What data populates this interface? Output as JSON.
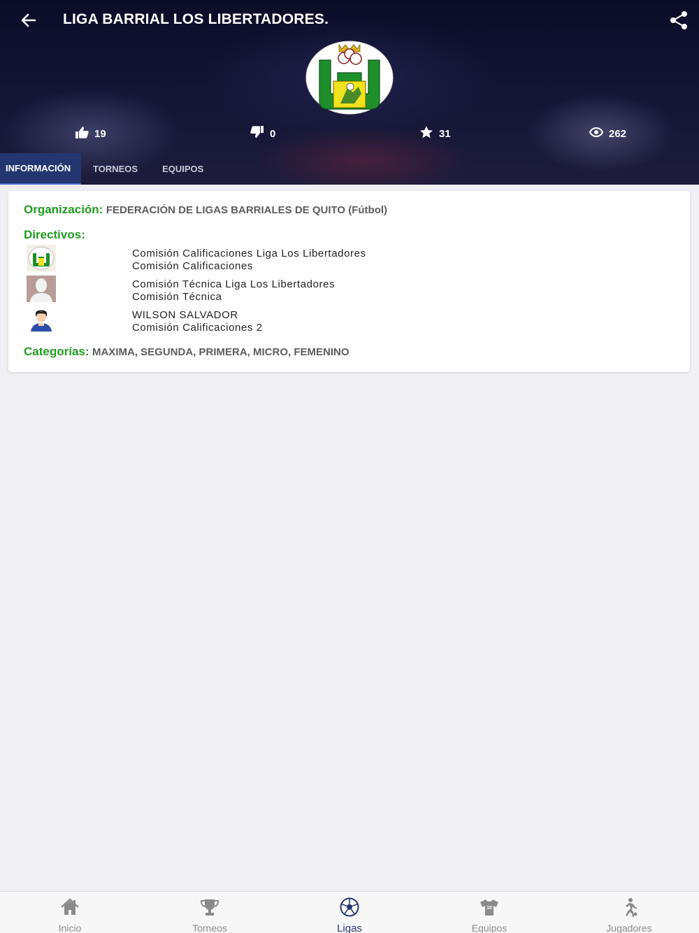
{
  "header": {
    "title": "LIGA BARRIAL LOS LIBERTADORES.",
    "back_icon": "arrow-left-icon",
    "share_icon": "share-icon"
  },
  "stats": [
    {
      "icon": "thumbs-up-icon",
      "value": "19"
    },
    {
      "icon": "thumbs-down-icon",
      "value": "0"
    },
    {
      "icon": "star-icon",
      "value": "31"
    },
    {
      "icon": "eye-icon",
      "value": "262"
    }
  ],
  "tabs": [
    {
      "label": "INFORMACIÓN",
      "active": true
    },
    {
      "label": "TORNEOS",
      "active": false
    },
    {
      "label": "EQUIPOS",
      "active": false
    }
  ],
  "info": {
    "organization_label": "Organización:",
    "organization_value": "FEDERACIÓN DE LIGAS BARRIALES DE QUITO (Fútbol)",
    "directivos_label": "Directivos:",
    "directivos": [
      {
        "name": "Comisión Calificaciones Liga Los Libertadores",
        "role": "Comisión Calificaciones"
      },
      {
        "name": "Comisión Técnica Liga Los Libertadores",
        "role": "Comisión Técnica"
      },
      {
        "name": "WILSON SALVADOR",
        "role": "Comisión Calificaciones 2"
      }
    ],
    "categories_label": "Categorías:",
    "categories_value": "MAXIMA, SEGUNDA, PRIMERA, MICRO, FEMENINO"
  },
  "bottom_nav": [
    {
      "label": "Inicio",
      "icon": "home-icon",
      "active": false
    },
    {
      "label": "Torneos",
      "icon": "trophy-icon",
      "active": false
    },
    {
      "label": "Ligas",
      "icon": "soccer-ball-icon",
      "active": true
    },
    {
      "label": "Equipos",
      "icon": "jersey-icon",
      "active": false
    },
    {
      "label": "Jugadores",
      "icon": "player-icon",
      "active": false
    }
  ],
  "colors": {
    "accent_green": "#1f9c20",
    "active_tab": "#24366f",
    "header_dark": "#0b0d27"
  }
}
